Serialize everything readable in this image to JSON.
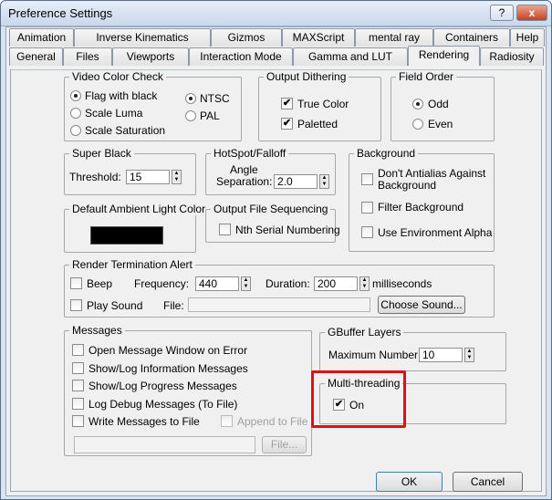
{
  "window": {
    "title": "Preference Settings",
    "help_label": "?",
    "close_label": "x"
  },
  "tabs_row1": [
    "Animation",
    "Inverse Kinematics",
    "Gizmos",
    "MAXScript",
    "mental ray",
    "Containers",
    "Help"
  ],
  "tabs_row2": [
    "General",
    "Files",
    "Viewports",
    "Interaction Mode",
    "Gamma and LUT",
    "Rendering",
    "Radiosity"
  ],
  "active_tab": "Rendering",
  "video_color_check": {
    "title": "Video Color Check",
    "options": [
      "Flag with black",
      "Scale Luma",
      "Scale Saturation"
    ],
    "selected": "Flag with black",
    "standards": [
      "NTSC",
      "PAL"
    ],
    "standard_selected": "NTSC"
  },
  "output_dithering": {
    "title": "Output Dithering",
    "true_color": "True Color",
    "true_color_checked": true,
    "paletted": "Paletted",
    "paletted_checked": true
  },
  "field_order": {
    "title": "Field Order",
    "options": [
      "Odd",
      "Even"
    ],
    "selected": "Odd"
  },
  "super_black": {
    "title": "Super Black",
    "threshold_label": "Threshold:",
    "threshold_value": "15"
  },
  "hotspot": {
    "title": "HotSpot/Falloff",
    "angle_label": "Angle",
    "separation_label": "Separation:",
    "separation_value": "2.0"
  },
  "background": {
    "title": "Background",
    "dont_antialias": "Don't Antialias Against Background",
    "filter_background": "Filter Background",
    "use_env_alpha": "Use Environment Alpha"
  },
  "ambient": {
    "title": "Default Ambient Light Color",
    "swatch_color": "#000000"
  },
  "ofs": {
    "title": "Output File Sequencing",
    "nth_serial": "Nth Serial Numbering"
  },
  "render_alert": {
    "title": "Render Termination Alert",
    "beep": "Beep",
    "frequency_label": "Frequency:",
    "frequency_value": "440",
    "duration_label": "Duration:",
    "duration_value": "200",
    "ms_label": "milliseconds",
    "play_sound": "Play Sound",
    "file_label": "File:",
    "file_value": "",
    "choose_sound": "Choose Sound..."
  },
  "messages": {
    "title": "Messages",
    "items": [
      "Open Message Window on Error",
      "Show/Log Information Messages",
      "Show/Log Progress Messages",
      "Log Debug Messages (To File)",
      "Write Messages to File"
    ],
    "append_label": "Append to File",
    "file_button": "File..."
  },
  "gbuffer": {
    "title": "GBuffer Layers",
    "max_label": "Maximum Number:",
    "max_value": "10"
  },
  "multithreading": {
    "title": "Multi-threading",
    "on_label": "On",
    "on_checked": true
  },
  "footer": {
    "ok": "OK",
    "cancel": "Cancel"
  }
}
